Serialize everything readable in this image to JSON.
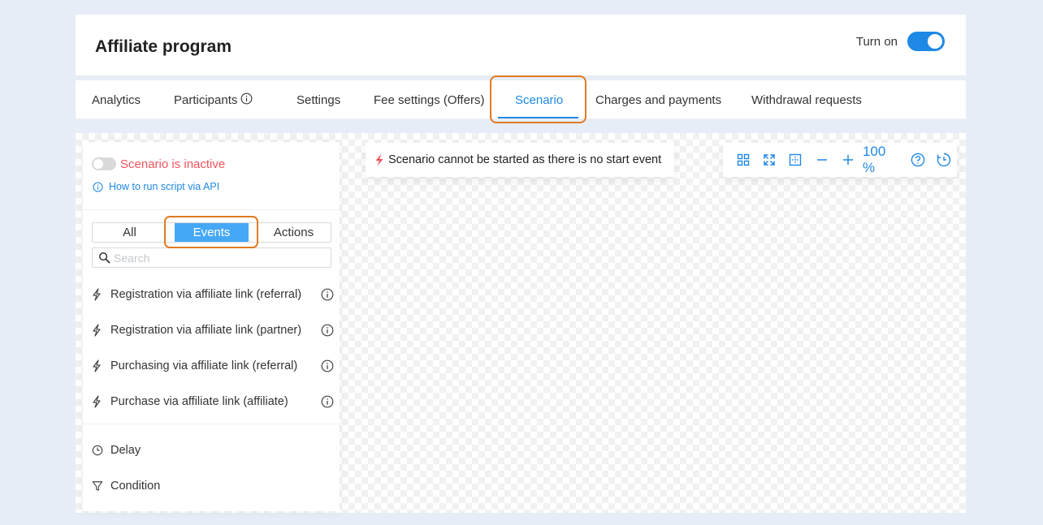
{
  "header": {
    "title": "Affiliate program",
    "turn_on_label": "Turn on",
    "turn_on_state": true
  },
  "tabs": [
    {
      "label": "Analytics"
    },
    {
      "label": "Participants"
    },
    {
      "label": "Settings"
    },
    {
      "label": "Fee settings (Offers)"
    },
    {
      "label": "Scenario",
      "active": true
    },
    {
      "label": "Charges and payments"
    },
    {
      "label": "Withdrawal requests"
    }
  ],
  "panel": {
    "status": "Scenario is inactive",
    "api_link": "How to run script via API",
    "filters": [
      "All",
      "Events",
      "Actions"
    ],
    "active_filter": "Events",
    "search_placeholder": "Search",
    "events": [
      {
        "label": "Registration via affiliate link (referral)"
      },
      {
        "label": "Registration via affiliate link (partner)"
      },
      {
        "label": "Purchasing via affiliate link (referral)"
      },
      {
        "label": "Purchase via affiliate link (affiliate)"
      }
    ],
    "actions": [
      {
        "label": "Delay"
      },
      {
        "label": "Condition"
      }
    ]
  },
  "canvas": {
    "warning": "Scenario cannot be started as there is no start event",
    "zoom": "100 %"
  },
  "colors": {
    "accent": "#1e88e5",
    "inactive": "#f0525b",
    "highlight": "#e07b22",
    "segment_active": "#45a8f7"
  },
  "icons": [
    "info-icon",
    "bolt-icon",
    "search-icon",
    "clock-icon",
    "filter-icon",
    "grid-icon",
    "fit-icon",
    "frame-icon",
    "minus-icon",
    "plus-icon",
    "help-icon",
    "history-icon"
  ]
}
